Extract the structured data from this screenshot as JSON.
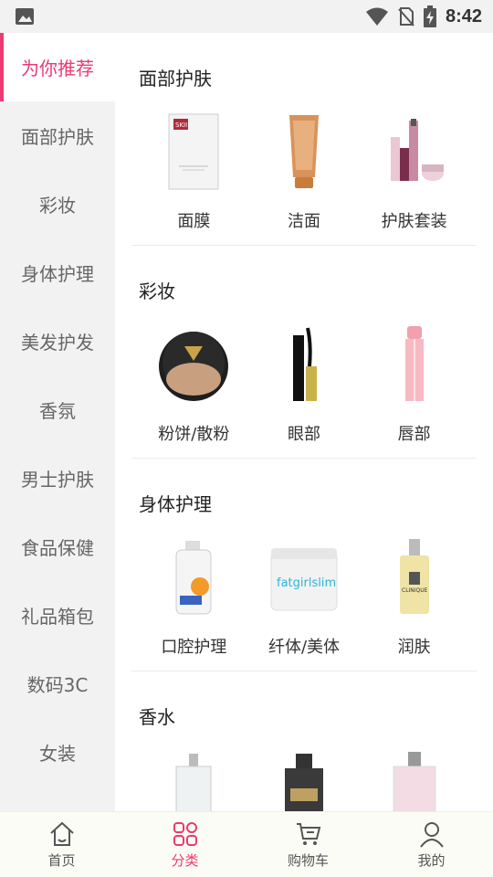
{
  "status_bar": {
    "time": "8:42",
    "image_icon": "image-icon",
    "wifi_icon": "wifi-icon",
    "no_sim_icon": "no-sim-icon",
    "battery_icon": "battery-charging-icon"
  },
  "sidebar": {
    "items": [
      {
        "label": "为你推荐",
        "active": true
      },
      {
        "label": "面部护肤"
      },
      {
        "label": "彩妆"
      },
      {
        "label": "身体护理"
      },
      {
        "label": "美发护发"
      },
      {
        "label": "香氛"
      },
      {
        "label": "男士护肤"
      },
      {
        "label": "食品保健"
      },
      {
        "label": "礼品箱包"
      },
      {
        "label": "数码3C"
      },
      {
        "label": "女装"
      }
    ]
  },
  "sections": [
    {
      "title": "面部护肤",
      "items": [
        {
          "label": "面膜"
        },
        {
          "label": "洁面"
        },
        {
          "label": "护肤套装"
        }
      ]
    },
    {
      "title": "彩妆",
      "items": [
        {
          "label": "粉饼/散粉"
        },
        {
          "label": "眼部"
        },
        {
          "label": "唇部"
        }
      ]
    },
    {
      "title": "身体护理",
      "items": [
        {
          "label": "口腔护理"
        },
        {
          "label": "纤体/美体"
        },
        {
          "label": "润肤"
        }
      ]
    },
    {
      "title": "香水",
      "items": [
        {
          "label": ""
        },
        {
          "label": ""
        },
        {
          "label": ""
        }
      ]
    }
  ],
  "product_images": {
    "mask_brand": "SKII",
    "body_brand": "fatgirlslim",
    "lotion_brand": "CLINIQUE"
  },
  "bottom_nav": {
    "items": [
      {
        "label": "首页",
        "icon": "home-icon"
      },
      {
        "label": "分类",
        "icon": "category-icon",
        "active": true
      },
      {
        "label": "购物车",
        "icon": "cart-icon"
      },
      {
        "label": "我的",
        "icon": "user-icon"
      }
    ]
  },
  "colors": {
    "accent": "#ec3a73",
    "sidebar_bg": "#f2f2f2"
  }
}
